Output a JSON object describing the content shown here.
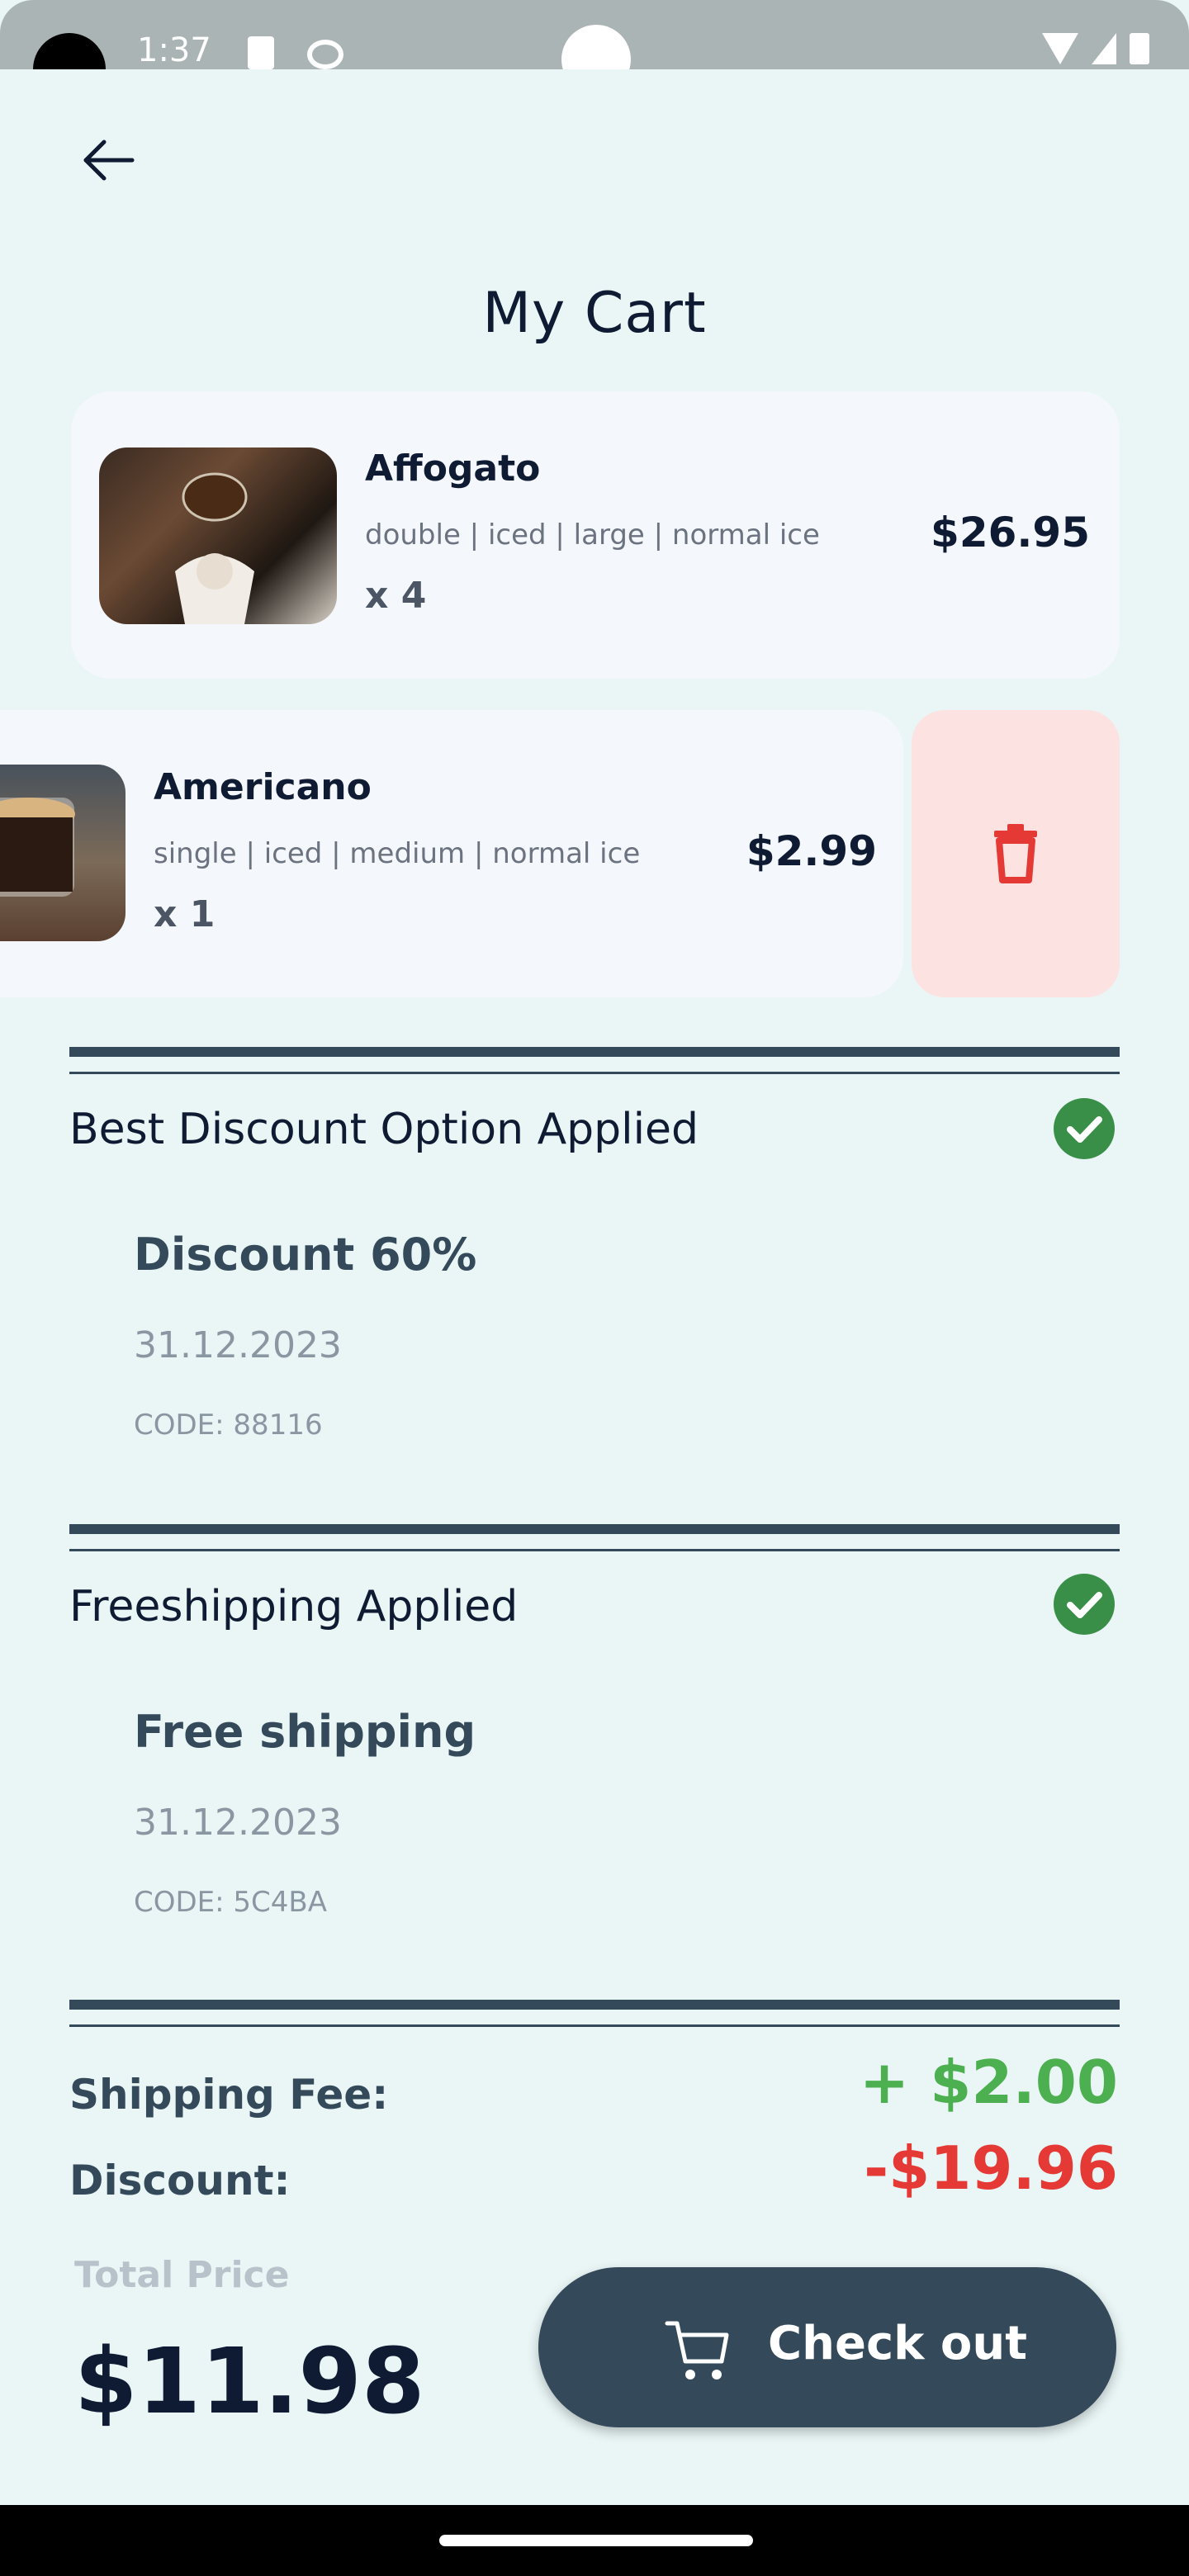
{
  "status_bar": {
    "time": "1:37"
  },
  "header": {
    "title": "My Cart"
  },
  "cart": {
    "items": [
      {
        "name": "Affogato",
        "options": "double | iced | large | normal ice",
        "quantity": "x 4",
        "price": "$26.95"
      },
      {
        "name": "Americano",
        "options": "single | iced | medium | normal ice",
        "quantity": "x 1",
        "price": "$2.99"
      }
    ]
  },
  "discount_section": {
    "label": "Best Discount Option Applied",
    "promo_title": "Discount 60%",
    "promo_date": "31.12.2023",
    "promo_code": "CODE: 88116"
  },
  "shipping_section": {
    "label": "Freeshipping Applied",
    "promo_title": "Free shipping",
    "promo_date": "31.12.2023",
    "promo_code": "CODE: 5C4BA"
  },
  "summary": {
    "shipping_label": "Shipping Fee:",
    "shipping_value": "+ $2.00",
    "discount_label": "Discount:",
    "discount_value": "-$19.96",
    "total_label": "Total Price",
    "total_value": "$11.98"
  },
  "checkout": {
    "label": "Check out"
  },
  "colors": {
    "background": "#eaf6f6",
    "card": "#f4f7fb",
    "dark_accent": "#34495a",
    "positive": "#4caf50",
    "negative": "#e53935",
    "delete_bg": "#fde2e2",
    "check": "#3a8f48"
  },
  "icons": {
    "back": "arrow-left-icon",
    "delete": "trash-icon",
    "check": "check-circle-icon",
    "checkout": "cart-icon"
  }
}
